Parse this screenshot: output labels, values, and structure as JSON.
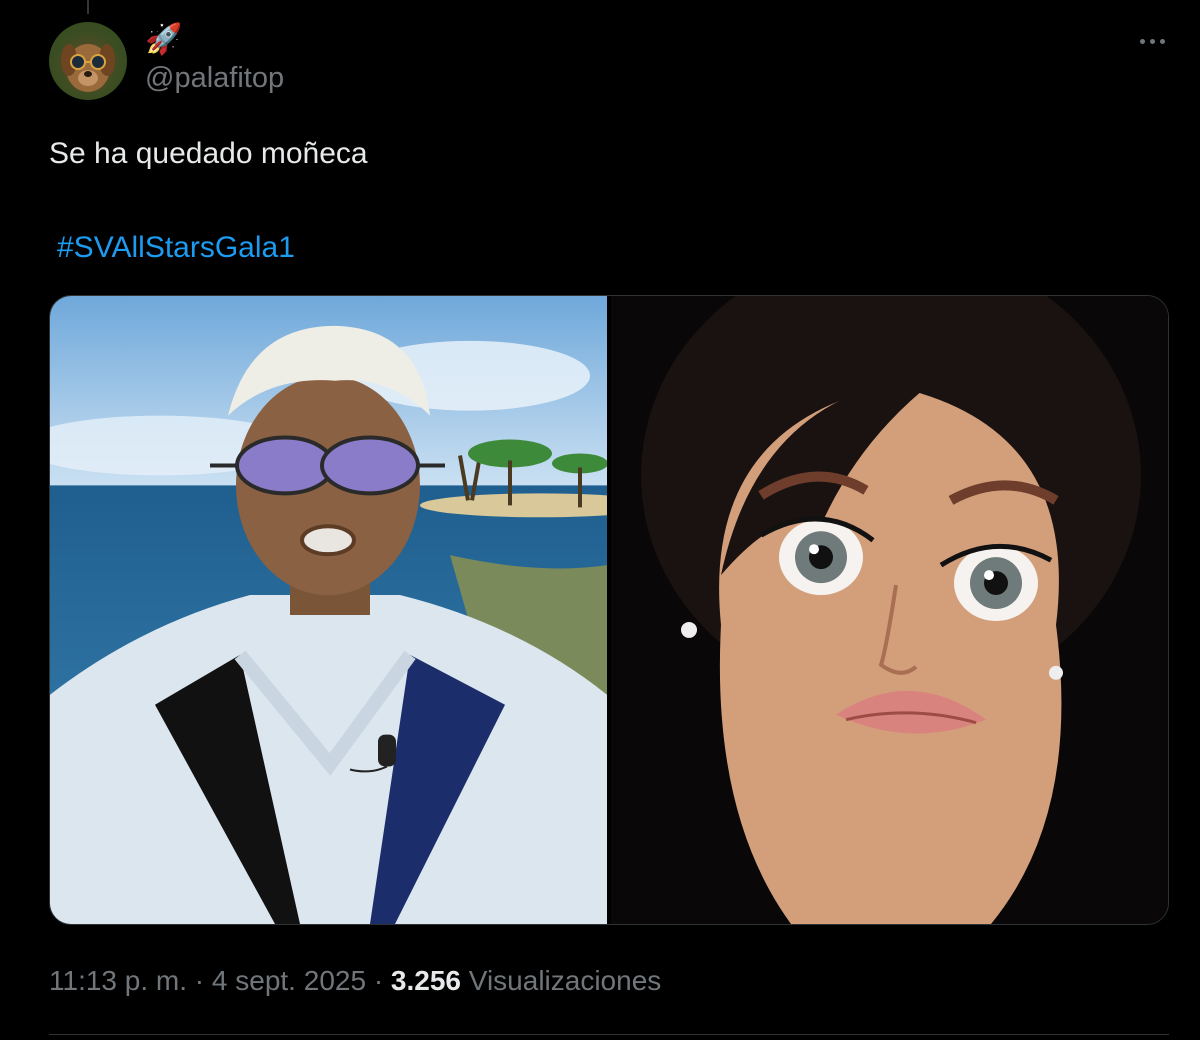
{
  "tweet": {
    "display_name_emoji": "🚀",
    "handle": "@palafitop",
    "text": "Se ha quedado moñeca",
    "hashtag": "#SVAllStarsGala1",
    "time": "11:13 p. m.",
    "separator": "·",
    "date": "4 sept. 2025",
    "view_count": "3.256",
    "views_label": "Visualizaciones"
  },
  "icons": {
    "avatar": "dog-with-sunglasses-avatar",
    "more": "more-options-icon"
  },
  "media": {
    "photos": [
      "man-in-white-suit-sunglasses-beach",
      "doll-face-disgusted-expression"
    ]
  },
  "colors": {
    "background": "#000000",
    "text": "#e7e9ea",
    "secondary": "#71767b",
    "link": "#1d9bf0",
    "border": "#2f3336"
  }
}
